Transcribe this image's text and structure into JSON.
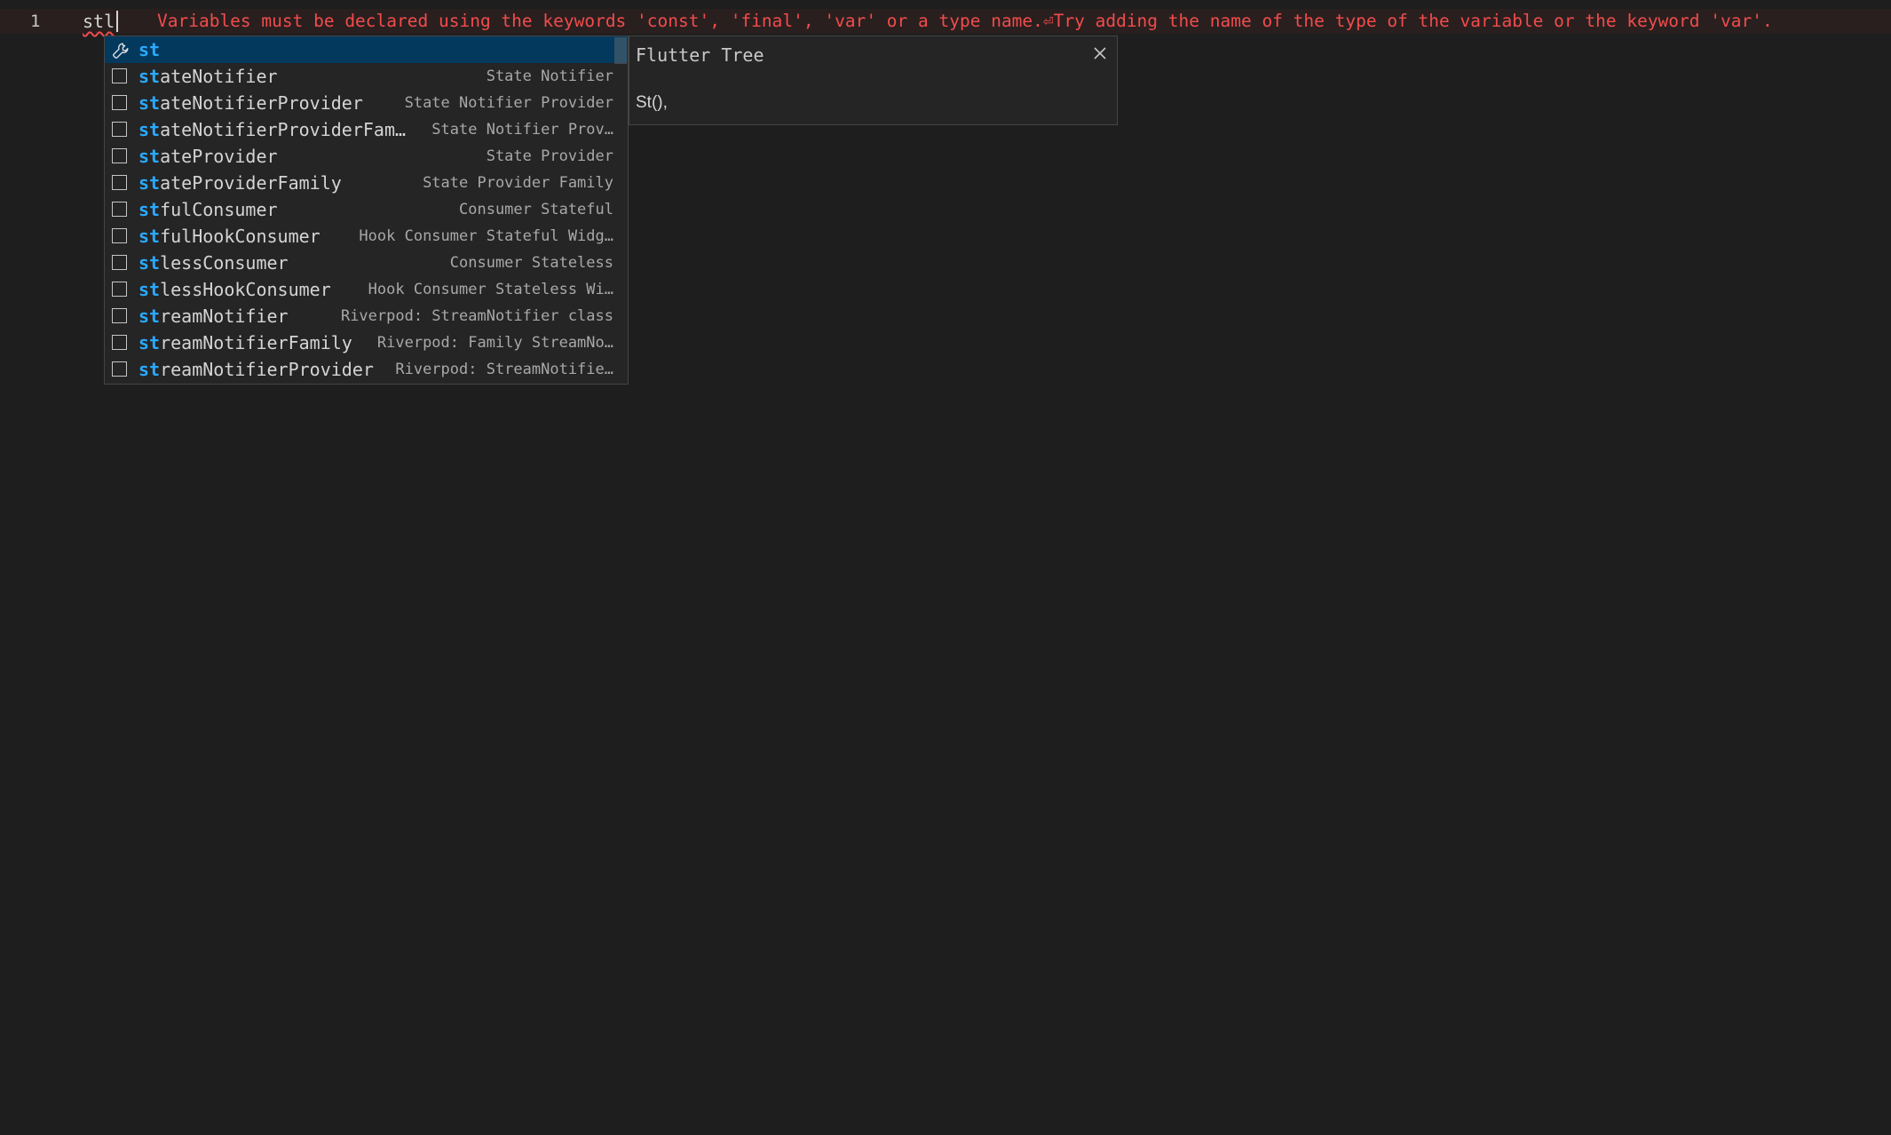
{
  "editor": {
    "line_number": "1",
    "code": "stl",
    "error_message": "Variables must be declared using the keywords 'const', 'final', 'var' or a type name.⏎Try adding the name of the type of the variable or the keyword 'var'."
  },
  "suggest": {
    "items": [
      {
        "match": "st",
        "rest": "",
        "detail": "",
        "icon": "wrench-icon",
        "selected": true
      },
      {
        "match": "st",
        "rest": "ateNotifier",
        "detail": "State Notifier",
        "icon": "snippet-icon"
      },
      {
        "match": "st",
        "rest": "ateNotifierProvider",
        "detail": "State Notifier Provider",
        "icon": "snippet-icon"
      },
      {
        "match": "st",
        "rest": "ateNotifierProviderFam…",
        "detail": "State Notifier Prov…",
        "icon": "snippet-icon"
      },
      {
        "match": "st",
        "rest": "ateProvider",
        "detail": "State Provider",
        "icon": "snippet-icon"
      },
      {
        "match": "st",
        "rest": "ateProviderFamily",
        "detail": "State Provider Family",
        "icon": "snippet-icon"
      },
      {
        "match": "st",
        "rest": "fulConsumer",
        "detail": "Consumer Stateful",
        "icon": "snippet-icon"
      },
      {
        "match": "st",
        "rest": "fulHookConsumer",
        "detail": "Hook Consumer Stateful Widg…",
        "icon": "snippet-icon"
      },
      {
        "match": "st",
        "rest": "lessConsumer",
        "detail": "Consumer Stateless",
        "icon": "snippet-icon"
      },
      {
        "match": "st",
        "rest": "lessHookConsumer",
        "detail": "Hook Consumer Stateless Wi…",
        "icon": "snippet-icon"
      },
      {
        "match": "st",
        "rest": "reamNotifier",
        "detail": "Riverpod: StreamNotifier class",
        "icon": "snippet-icon"
      },
      {
        "match": "st",
        "rest": "reamNotifierFamily",
        "detail": "Riverpod: Family StreamNo…",
        "icon": "snippet-icon"
      },
      {
        "match": "st",
        "rest": "reamNotifierProvider",
        "detail": "Riverpod: StreamNotifie…",
        "icon": "snippet-icon"
      }
    ]
  },
  "details": {
    "title": "Flutter Tree",
    "body": "St(),"
  },
  "colors": {
    "background": "#1e1e1e",
    "error": "#f14c4c",
    "match": "#2aaaff",
    "selected_row": "#04395e",
    "widget_bg": "#252526"
  }
}
